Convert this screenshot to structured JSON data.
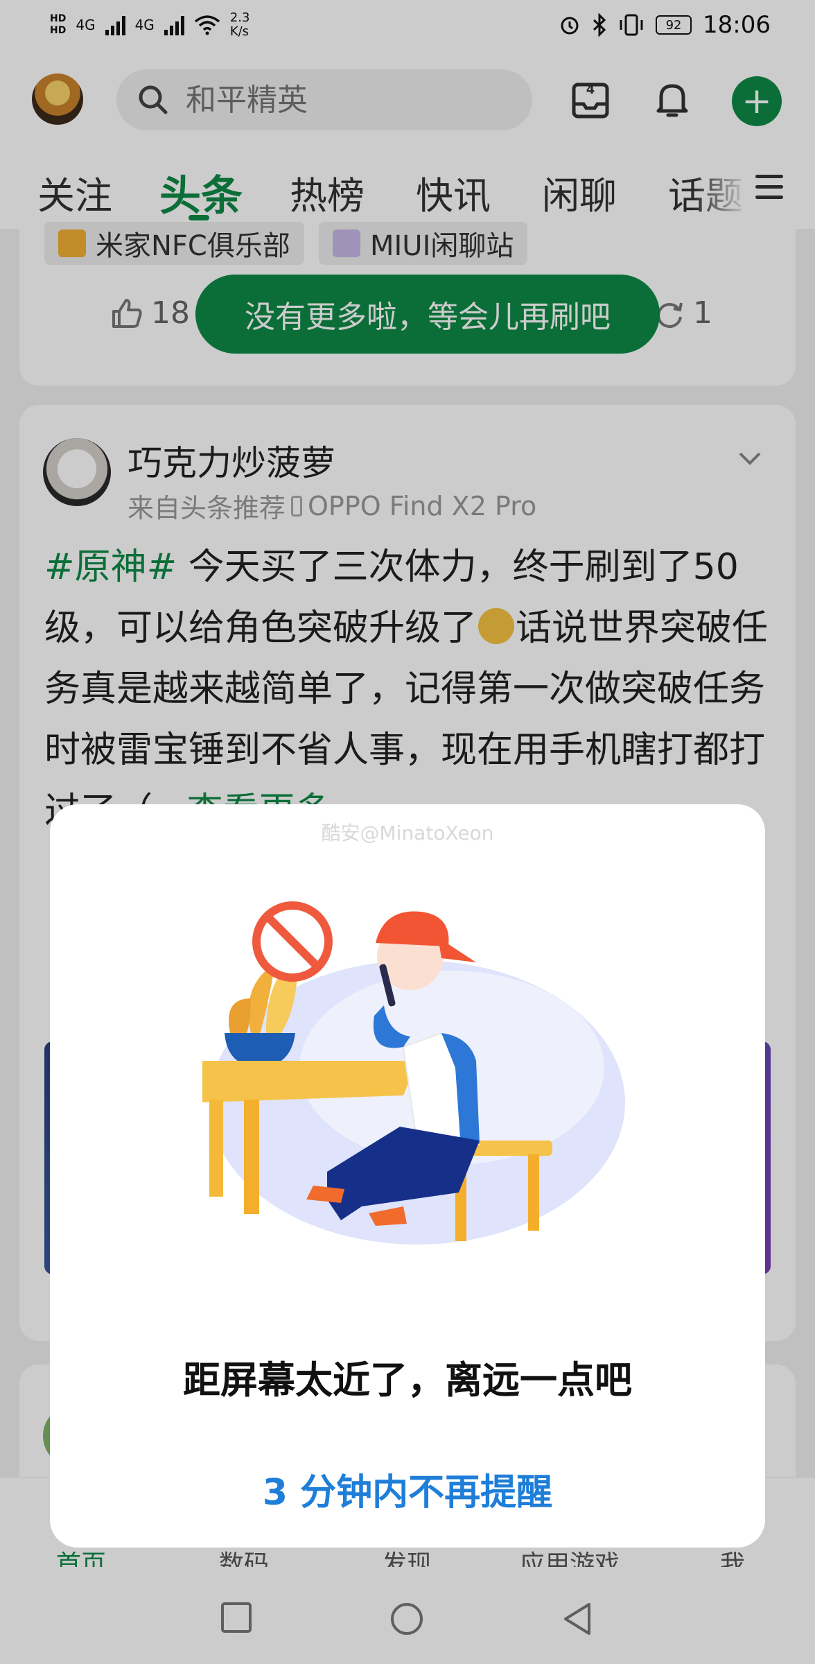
{
  "status_bar": {
    "hd_top": "HD",
    "hd_bottom": "HD",
    "net1": "4G",
    "net2": "4G",
    "speed_value": "2.3",
    "speed_unit": "K/s",
    "battery": "92",
    "time": "18:06"
  },
  "header": {
    "search_placeholder": "和平精英",
    "inbox_count": "4",
    "tabs": [
      "关注",
      "头条",
      "热榜",
      "快讯",
      "闲聊",
      "话题"
    ],
    "active_tab": "头条"
  },
  "feed": {
    "card1": {
      "chips": [
        "米家NFC俱乐部",
        "MIUI闲聊站"
      ],
      "like_count": "18",
      "share_count": "1"
    },
    "toast": "没有更多啦，等会儿再刷吧",
    "card2": {
      "author": "巧克力炒菠萝",
      "source": "来自头条推荐",
      "device": "OPPO Find X2 Pro",
      "tag": "#原神#",
      "text_part1": " 今天买了三次体力，终于刷到了50级，可以给角色突破升级了",
      "text_part2": "话说世界突破任务真是越来越简单了，记得第一次做突破任务时被雷宝锤到不省人事，现在用手机瞎打都打过了（",
      "more": "...查看更多"
    }
  },
  "dialog": {
    "watermark": "酷安@MinatoXeon",
    "message": "距屏幕太近了，离远一点吧",
    "action": "3 分钟内不再提醒"
  },
  "bottom_nav": {
    "items": [
      "首页",
      "数码",
      "发现",
      "应用游戏",
      "我"
    ],
    "active": "首页"
  },
  "colors": {
    "brand_green": "#0e8a47",
    "action_blue": "#1e7ed8"
  }
}
